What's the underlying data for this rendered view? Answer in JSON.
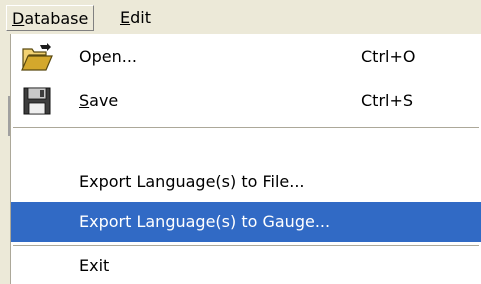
{
  "menubar": {
    "items": [
      {
        "mnemonic": "D",
        "rest": "atabase"
      },
      {
        "mnemonic": "E",
        "rest": "dit"
      }
    ]
  },
  "database_menu": {
    "open": {
      "label": "Open...",
      "shortcut": "Ctrl+O",
      "icon": "folder-open-icon"
    },
    "save": {
      "mnemonic": "S",
      "rest": "ave",
      "shortcut": "Ctrl+S",
      "icon": "floppy-disk-icon"
    },
    "export_file": {
      "label": "Export Language(s) to File..."
    },
    "export_gauge": {
      "label": "Export Language(s) to Gauge..."
    },
    "exit": {
      "label": "Exit"
    }
  },
  "colors": {
    "menu_background": "#ffffff",
    "menubar_background": "#ece9d8",
    "selection_background": "#316ac5",
    "selection_text": "#ffffff"
  }
}
